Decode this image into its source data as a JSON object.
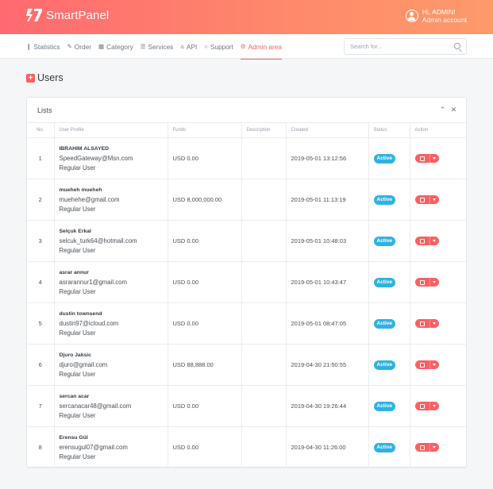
{
  "app": {
    "name": "SmartPanel"
  },
  "account": {
    "greeting": "Hi, ADMIN!",
    "role": "Admin account"
  },
  "nav": [
    {
      "label": "Statistics",
      "icon": "bar-chart-icon",
      "glyph": "❙",
      "active": false
    },
    {
      "label": "Order",
      "icon": "edit-icon",
      "glyph": "✎",
      "active": false
    },
    {
      "label": "Category",
      "icon": "table-icon",
      "glyph": "▦",
      "active": false
    },
    {
      "label": "Services",
      "icon": "list-icon",
      "glyph": "☰",
      "active": false
    },
    {
      "label": "API",
      "icon": "share-icon",
      "glyph": "⩟",
      "active": false
    },
    {
      "label": "Support",
      "icon": "chat-icon",
      "glyph": "○",
      "active": false
    },
    {
      "label": "Admin area",
      "icon": "settings-icon",
      "glyph": "⚙",
      "active": true
    }
  ],
  "search": {
    "placeholder": "Search for..."
  },
  "page": {
    "title": "Users"
  },
  "card": {
    "title": "Lists"
  },
  "table": {
    "headers": [
      "No.",
      "User Profile",
      "Funds",
      "Description",
      "Created",
      "Status",
      "Action"
    ],
    "rows": [
      {
        "no": "1",
        "name": "IBRAHIM ALSAYED",
        "email": "SpeedGateway@Msn.com",
        "role": "Regular User",
        "funds": "USD 0.00",
        "description": "",
        "created": "2019-05-01 13:12:56",
        "status": "Active"
      },
      {
        "no": "2",
        "name": "mueheh mueheh",
        "email": "muehehe@gmail.com",
        "role": "Regular User",
        "funds": "USD 8,000,000.00",
        "description": "",
        "created": "2019-05-01 11:13:19",
        "status": "Active"
      },
      {
        "no": "3",
        "name": "Selçuk Erkal",
        "email": "selcuk_turk64@hotmail.com",
        "role": "Regular User",
        "funds": "USD 0.00",
        "description": "",
        "created": "2019-05-01 10:48:03",
        "status": "Active"
      },
      {
        "no": "4",
        "name": "asrar annur",
        "email": "asrarannur1@gmail.com",
        "role": "Regular User",
        "funds": "USD 0.00",
        "description": "",
        "created": "2019-05-01 10:43:47",
        "status": "Active"
      },
      {
        "no": "5",
        "name": "dustin townsend",
        "email": "dustin97@icloud.com",
        "role": "Regular User",
        "funds": "USD 0.00",
        "description": "",
        "created": "2019-05-01 08:47:05",
        "status": "Active"
      },
      {
        "no": "6",
        "name": "Djuro Jaksic",
        "email": "djuro@gmail.com",
        "role": "Regular User",
        "funds": "USD 88,888.00",
        "description": "",
        "created": "2019-04-30 21:50:55",
        "status": "Active"
      },
      {
        "no": "7",
        "name": "sercan acar",
        "email": "sercanacar48@gmail.com",
        "role": "Regular User",
        "funds": "USD 0.00",
        "description": "",
        "created": "2019-04-30 19:26:44",
        "status": "Active"
      },
      {
        "no": "8",
        "name": "Erensu Gül",
        "email": "erensugul07@gmail.com",
        "role": "Regular User",
        "funds": "USD 0.00",
        "description": "",
        "created": "2019-04-30 11:26:00",
        "status": "Active"
      }
    ]
  },
  "colors": {
    "accent": "#fc5f62",
    "header_start": "#ff6a6f",
    "header_end": "#fd9a6a",
    "status_active": "#2fb2e3"
  }
}
